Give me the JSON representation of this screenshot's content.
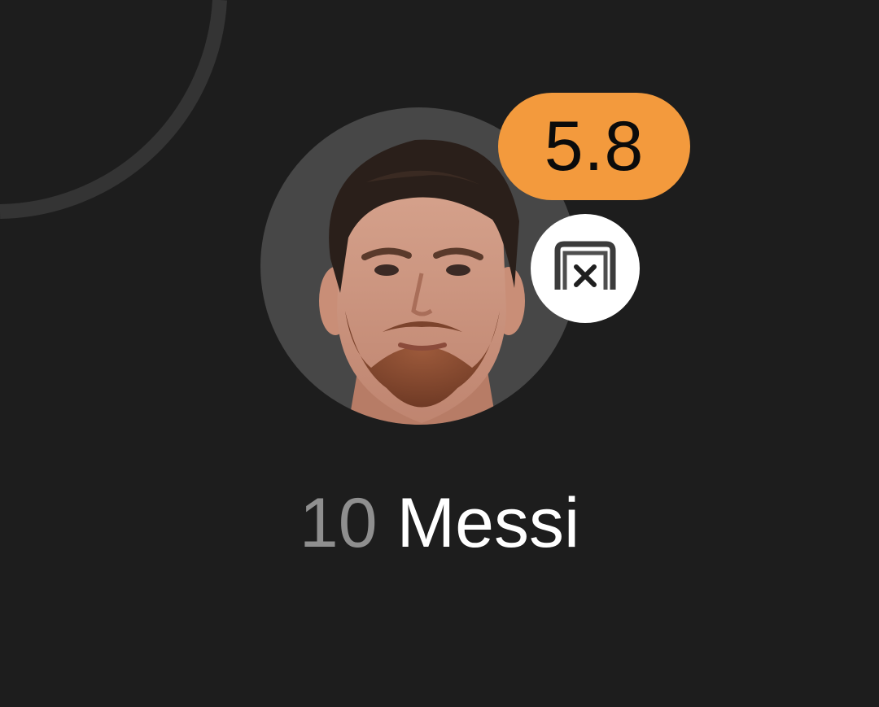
{
  "player": {
    "number": "10",
    "name": "Messi",
    "rating": "5.8",
    "photo": "player-headshot",
    "event_icon": "goal-miss-icon"
  },
  "colors": {
    "background": "#1d1d1d",
    "rating_badge": "#f39a3d",
    "avatar_background": "#474747",
    "number_text": "#8f8f8f",
    "name_text": "#ffffff"
  }
}
